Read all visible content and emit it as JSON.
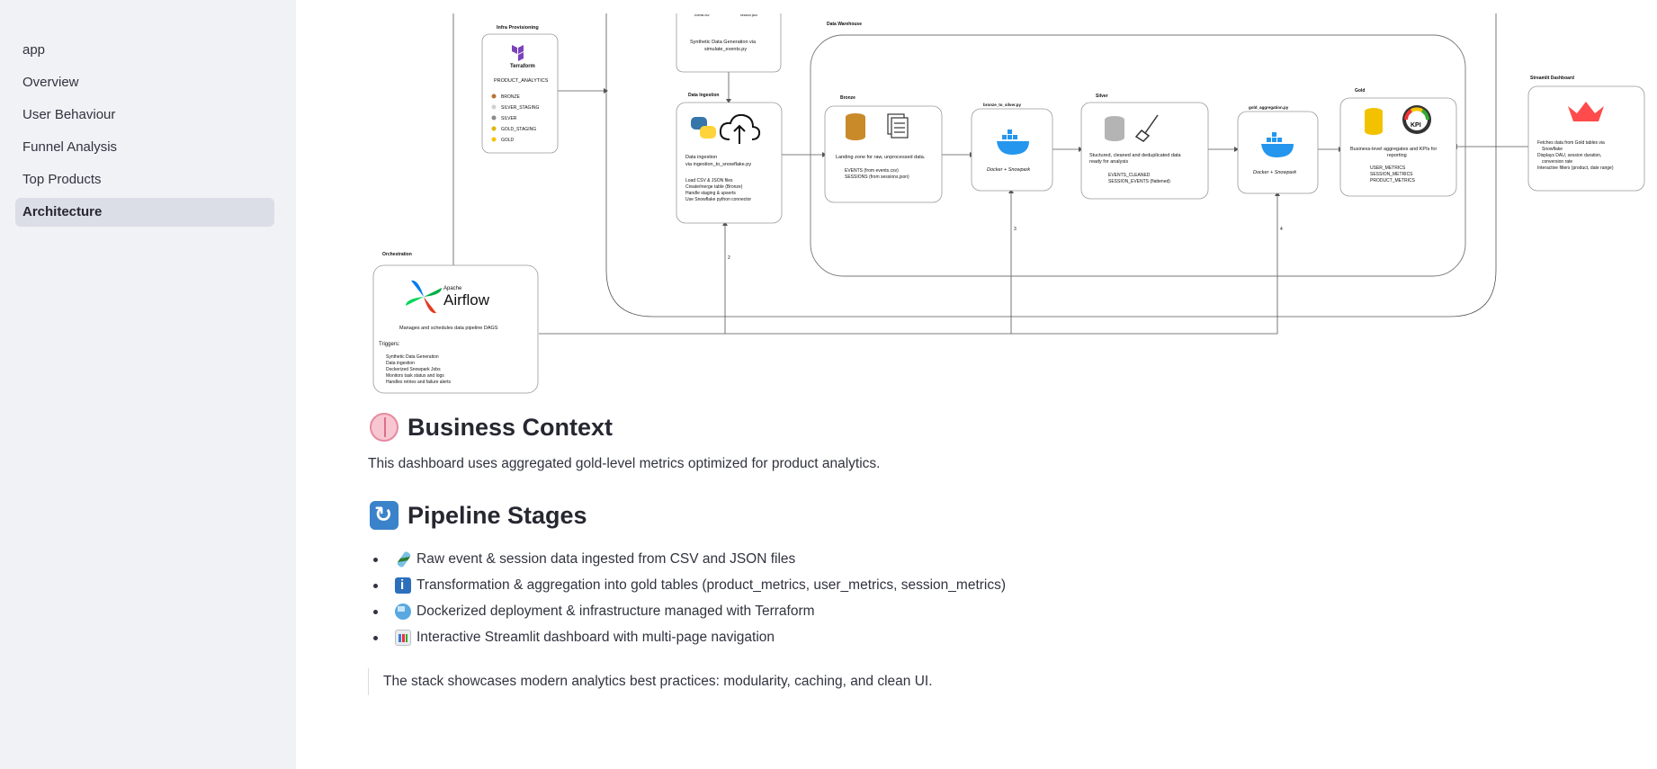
{
  "sidebar": {
    "items": [
      {
        "label": "app",
        "active": false
      },
      {
        "label": "Overview",
        "active": false
      },
      {
        "label": "User Behaviour",
        "active": false
      },
      {
        "label": "Funnel Analysis",
        "active": false
      },
      {
        "label": "Top Products",
        "active": false
      },
      {
        "label": "Architecture",
        "active": true
      }
    ]
  },
  "diagram": {
    "infra_title": "Infra Provisioning",
    "terraform_label": "Terraform",
    "product_analytics": "PRODUCT_ANALYTICS",
    "schemas": [
      "BRONZE",
      "SILVER_STAGING",
      "SILVER",
      "GOLD_STAGING",
      "GOLD"
    ],
    "schema_colors": [
      "#b87333",
      "#c0c0c0",
      "#8a8a8a",
      "#e0b400",
      "#f5c400"
    ],
    "synth_top": [
      "events.csv",
      "session.json"
    ],
    "synth_caption": [
      "Synthetic Data Generation via",
      "simulate_events.py"
    ],
    "ingestion_title": "Data Ingestion",
    "ingestion_caption": [
      "Data ingestion",
      "via ingestion_to_snowflake.py"
    ],
    "ingestion_bullets": [
      "Load CSV & JSON files",
      "Create/merge table (Bronze)",
      "Handle staging & upserts",
      "Use Snowflake python connector"
    ],
    "warehouse_title": "Data Warehouse",
    "bronze_title": "Bronze",
    "bronze_caption": "Landing zone for raw, unprocessed data.",
    "bronze_bullets": [
      "EVENTS (from events.csv)",
      "SESSIONS (from sessions.json)"
    ],
    "b2s_title": "bronze_to_silver.py",
    "docker_label": "Docker + Snowpark",
    "silver_title": "Silver",
    "silver_caption": [
      "Stuctured, cleaned and deduplicated data",
      "ready for analysis"
    ],
    "silver_bullets": [
      "EVENTS_CLEANED",
      "SESSION_EVENTS (flattened)"
    ],
    "gold_agg_title": "gold_aggregation.py",
    "gold_title": "Gold",
    "gold_caption": [
      "Business-level aggregates and KPIs for",
      "reporting"
    ],
    "gold_bullets": [
      "USER_METRICS",
      "SESSION_METRICS",
      "PRODUCT_METRICS"
    ],
    "kpi_label": "KPI",
    "streamlit_title": "Streamlit Dashboard",
    "streamlit_bullets": [
      "Fetches data from Gold tables via",
      "Snowflake",
      "Displays DAU, session duration,",
      "conversion rate",
      "Interactive filters  (product, date range)"
    ],
    "orchestration_title": "Orchestration",
    "airflow_small": "Apache",
    "airflow_big": "Airflow",
    "airflow_caption": "Manages and schedules data pipeline DAGS",
    "airflow_triggers": "Triggers:",
    "airflow_bullets": [
      "Synthetic Data Generation",
      "Data ingestion",
      "Dockerized Snowpark Jobs",
      "Monitors task status and logs",
      "Handles retries and failure alerts"
    ],
    "step_numbers": [
      "2",
      "3",
      "4"
    ]
  },
  "business": {
    "title": "Business Context",
    "text": "This dashboard uses aggregated gold-level metrics optimized for product analytics."
  },
  "pipeline": {
    "title": "Pipeline Stages",
    "items": [
      {
        "icon": "test-tube-icon",
        "text": "Raw event & session data ingested from CSV and JSON files"
      },
      {
        "icon": "info-icon",
        "text": "Transformation & aggregation into gold tables (product_metrics, user_metrics, session_metrics)"
      },
      {
        "icon": "docker-whale-icon",
        "text": "Dockerized deployment & infrastructure managed with Terraform"
      },
      {
        "icon": "bar-chart-icon",
        "text": "Interactive Streamlit dashboard with multi-page navigation"
      }
    ]
  },
  "quote": "The stack showcases modern analytics best practices: modularity, caching, and clean UI."
}
